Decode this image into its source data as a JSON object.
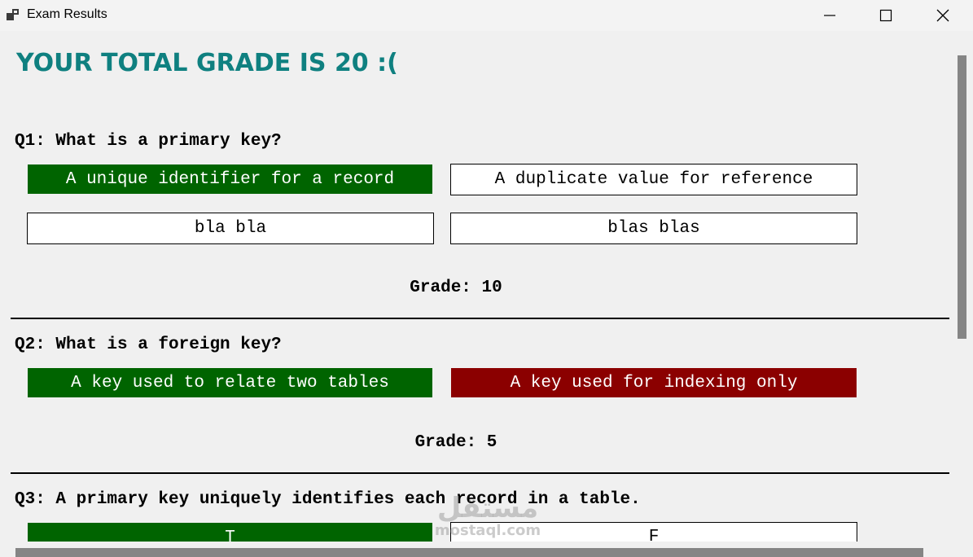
{
  "window": {
    "title": "Exam Results",
    "icons": {
      "app": "app-windows-icon",
      "minimize": "minimize-icon",
      "maximize": "maximize-icon",
      "close": "close-icon"
    }
  },
  "colors": {
    "title_teal": "#0f8080",
    "correct_green": "#006400",
    "wrong_red": "#8b0000"
  },
  "results": {
    "total_grade_text": "Your Total Grade is 20  :(",
    "questions": [
      {
        "text": "Q1: What is a primary key?",
        "options": [
          {
            "label": "A unique identifier for a record",
            "state": "correct"
          },
          {
            "label": "A duplicate value for reference",
            "state": "neutral"
          },
          {
            "label": "bla bla",
            "state": "neutral"
          },
          {
            "label": "blas blas",
            "state": "neutral"
          }
        ],
        "grade_text": "Grade: 10"
      },
      {
        "text": "Q2: What is a foreign key?",
        "options": [
          {
            "label": "A key used to relate two tables",
            "state": "correct"
          },
          {
            "label": "A key used for indexing only",
            "state": "wrong"
          }
        ],
        "grade_text": "Grade: 5"
      },
      {
        "text": "Q3: A primary key uniquely identifies each record in a table.",
        "options": [
          {
            "label": "T",
            "state": "correct"
          },
          {
            "label": "F",
            "state": "neutral"
          }
        ]
      }
    ]
  },
  "watermark": {
    "logo": "مستقل",
    "url": "mostaql.com"
  }
}
